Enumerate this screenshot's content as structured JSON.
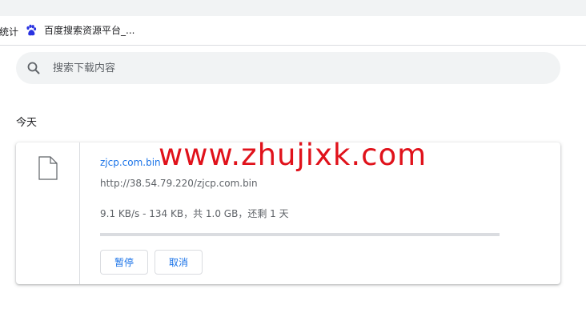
{
  "bookmarks": {
    "partial_label": "统计",
    "items": [
      {
        "icon": "baidu-paw-icon",
        "label": "百度搜索资源平台_..."
      }
    ]
  },
  "search": {
    "placeholder": "搜索下载内容",
    "value": ""
  },
  "downloads": {
    "section_label": "今天",
    "items": [
      {
        "file_icon": "file-icon",
        "file_name": "zjcp.com.bin",
        "url": "http://38.54.79.220/zjcp.com.bin",
        "status": "9.1 KB/s - 134 KB，共 1.0 GB，还剩 1 天",
        "progress": 0.0001,
        "pause_label": "暂停",
        "cancel_label": "取消"
      }
    ]
  },
  "watermark": "www.zhujixk.com",
  "colors": {
    "accent": "#1a73e8",
    "watermark": "#e0121b",
    "muted_text": "#5f6368"
  }
}
